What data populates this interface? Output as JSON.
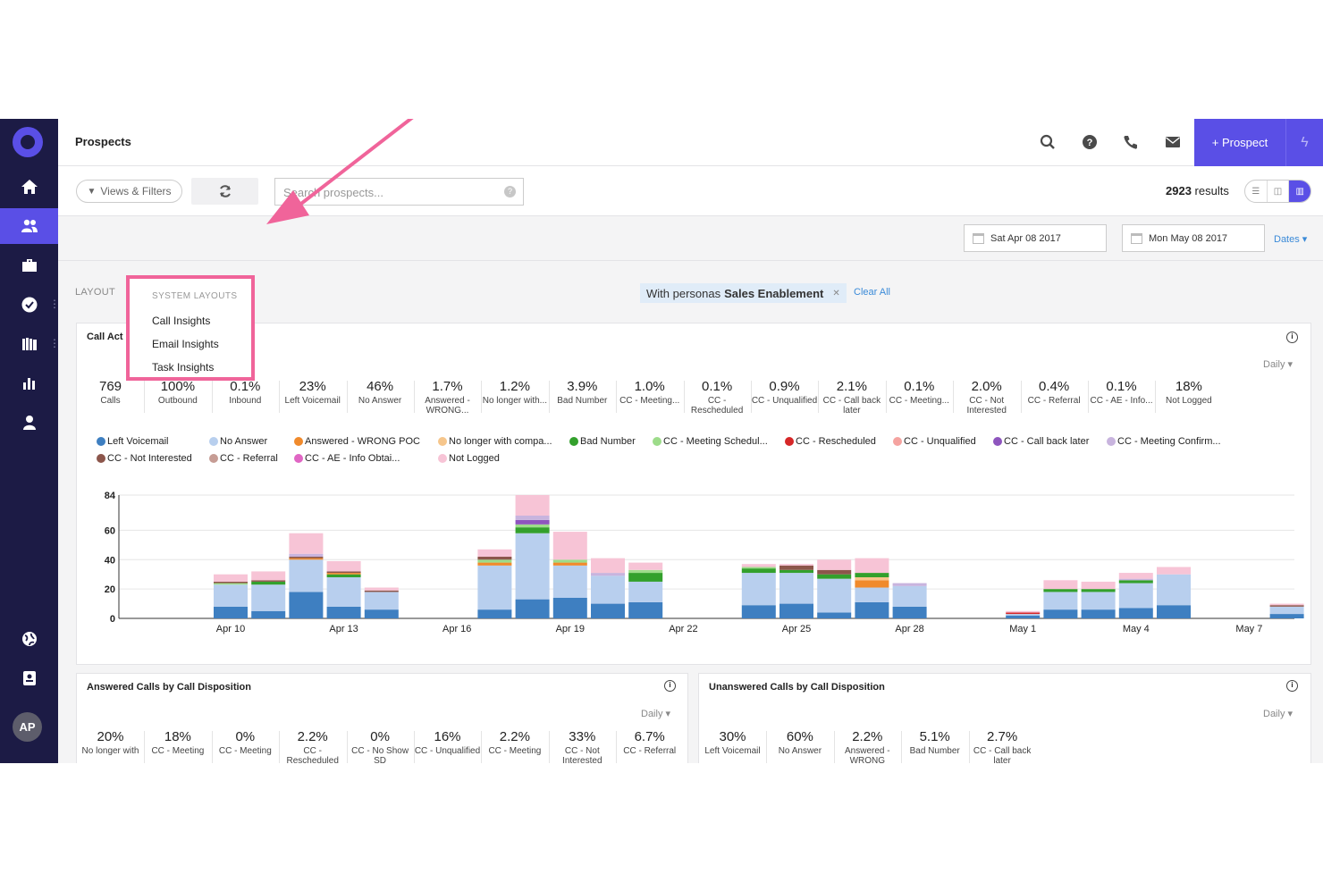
{
  "header": {
    "title": "Prospects",
    "prospect_button": "+ Prospect"
  },
  "sidebar": {
    "avatar": "AP",
    "items": [
      "home",
      "prospects",
      "briefcase",
      "tasks",
      "library",
      "reports",
      "person",
      "globe",
      "contacts"
    ]
  },
  "toolbar": {
    "views_filters": "Views & Filters",
    "search_placeholder": "Search prospects...",
    "results_count": "2923",
    "results_label": "results"
  },
  "dates": {
    "start": "Sat Apr 08 2017",
    "end": "Mon May 08 2017",
    "dates_label": "Dates"
  },
  "layout": {
    "label": "LAYOUT",
    "menu_header": "SYSTEM LAYOUTS",
    "items": [
      "Call Insights",
      "Email Insights",
      "Task Insights"
    ]
  },
  "filter": {
    "prefix": "With personas",
    "value": "Sales Enablement",
    "clear_all": "Clear All"
  },
  "call_activity": {
    "title": "Call Act",
    "period": "Daily",
    "stats": [
      {
        "v": "769",
        "l": "Calls"
      },
      {
        "v": "100%",
        "l": "Outbound"
      },
      {
        "v": "0.1%",
        "l": "Inbound"
      },
      {
        "v": "23%",
        "l": "Left Voicemail"
      },
      {
        "v": "46%",
        "l": "No Answer"
      },
      {
        "v": "1.7%",
        "l": "Answered - WRONG..."
      },
      {
        "v": "1.2%",
        "l": "No longer with..."
      },
      {
        "v": "3.9%",
        "l": "Bad Number"
      },
      {
        "v": "1.0%",
        "l": "CC - Meeting..."
      },
      {
        "v": "0.1%",
        "l": "CC - Rescheduled"
      },
      {
        "v": "0.9%",
        "l": "CC - Unqualified"
      },
      {
        "v": "2.1%",
        "l": "CC - Call back later"
      },
      {
        "v": "0.1%",
        "l": "CC - Meeting..."
      },
      {
        "v": "2.0%",
        "l": "CC - Not Interested"
      },
      {
        "v": "0.4%",
        "l": "CC - Referral"
      },
      {
        "v": "0.1%",
        "l": "CC - AE - Info..."
      },
      {
        "v": "18%",
        "l": "Not Logged"
      }
    ],
    "legend": [
      {
        "name": "Left Voicemail",
        "color": "#3e7fc1"
      },
      {
        "name": "No Answer",
        "color": "#b8cfee"
      },
      {
        "name": "Answered - WRONG POC",
        "color": "#f08a2c"
      },
      {
        "name": "No longer with compa...",
        "color": "#f6c68c"
      },
      {
        "name": "Bad Number",
        "color": "#33a02c"
      },
      {
        "name": "CC - Meeting Schedul...",
        "color": "#9ddc8a"
      },
      {
        "name": "CC - Rescheduled",
        "color": "#d62728"
      },
      {
        "name": "CC - Unqualified",
        "color": "#f5a3a0"
      },
      {
        "name": "CC - Call back later",
        "color": "#8e55be"
      },
      {
        "name": "CC - Meeting Confirm...",
        "color": "#c8b4de"
      },
      {
        "name": "CC - Not Interested",
        "color": "#8c564b"
      },
      {
        "name": "CC - Referral",
        "color": "#c69c94"
      },
      {
        "name": "CC - AE - Info Obtai...",
        "color": "#e066c4"
      },
      {
        "name": "Not Logged",
        "color": "#f7c4d6"
      }
    ]
  },
  "chart_data": {
    "type": "bar",
    "stacked": true,
    "ylim": [
      0,
      84
    ],
    "yticks": [
      0,
      20,
      40,
      60,
      84
    ],
    "x_labels": [
      {
        "label": "Apr 10",
        "day": 2
      },
      {
        "label": "Apr 13",
        "day": 5
      },
      {
        "label": "Apr 16",
        "day": 8
      },
      {
        "label": "Apr 19",
        "day": 11
      },
      {
        "label": "Apr 22",
        "day": 14
      },
      {
        "label": "Apr 25",
        "day": 17
      },
      {
        "label": "Apr 28",
        "day": 20
      },
      {
        "label": "May 1",
        "day": 23
      },
      {
        "label": "May 4",
        "day": 26
      },
      {
        "label": "May 7",
        "day": 29
      }
    ],
    "bars": [
      {
        "day": 2,
        "segments": [
          [
            "Left Voicemail",
            8
          ],
          [
            "No Answer",
            15
          ],
          [
            "CC - Meeting Schedul...",
            1
          ],
          [
            "CC - Not Interested",
            1
          ],
          [
            "Not Logged",
            5
          ]
        ]
      },
      {
        "day": 3,
        "segments": [
          [
            "Left Voicemail",
            5
          ],
          [
            "No Answer",
            18
          ],
          [
            "Bad Number",
            2
          ],
          [
            "CC - Not Interested",
            1
          ],
          [
            "Not Logged",
            6
          ]
        ]
      },
      {
        "day": 4,
        "segments": [
          [
            "Left Voicemail",
            18
          ],
          [
            "No Answer",
            22
          ],
          [
            "Answered - WRONG POC",
            1
          ],
          [
            "CC - Not Interested",
            1
          ],
          [
            "CC - Meeting Confirm...",
            2
          ],
          [
            "Not Logged",
            14
          ]
        ]
      },
      {
        "day": 5,
        "segments": [
          [
            "Left Voicemail",
            8
          ],
          [
            "No Answer",
            20
          ],
          [
            "Bad Number",
            2
          ],
          [
            "Answered - WRONG POC",
            1
          ],
          [
            "CC - Not Interested",
            1
          ],
          [
            "Not Logged",
            7
          ]
        ]
      },
      {
        "day": 6,
        "segments": [
          [
            "Left Voicemail",
            6
          ],
          [
            "No Answer",
            12
          ],
          [
            "CC - Not Interested",
            1
          ],
          [
            "Not Logged",
            2
          ]
        ]
      },
      {
        "day": 9,
        "segments": [
          [
            "Left Voicemail",
            6
          ],
          [
            "No Answer",
            30
          ],
          [
            "Answered - WRONG POC",
            2
          ],
          [
            "CC - Meeting Schedul...",
            2
          ],
          [
            "CC - Not Interested",
            2
          ],
          [
            "Not Logged",
            5
          ]
        ]
      },
      {
        "day": 10,
        "segments": [
          [
            "Left Voicemail",
            13
          ],
          [
            "No Answer",
            45
          ],
          [
            "Bad Number",
            4
          ],
          [
            "CC - Meeting Schedul...",
            2
          ],
          [
            "CC - Call back later",
            3
          ],
          [
            "CC - Meeting Confirm...",
            3
          ],
          [
            "Not Logged",
            14
          ]
        ]
      },
      {
        "day": 11,
        "segments": [
          [
            "Left Voicemail",
            14
          ],
          [
            "No Answer",
            22
          ],
          [
            "Answered - WRONG POC",
            2
          ],
          [
            "CC - Meeting Schedul...",
            2
          ],
          [
            "Not Logged",
            19
          ]
        ]
      },
      {
        "day": 12,
        "segments": [
          [
            "Left Voicemail",
            10
          ],
          [
            "No Answer",
            19
          ],
          [
            "CC - Meeting Confirm...",
            2
          ],
          [
            "Not Logged",
            10
          ]
        ]
      },
      {
        "day": 13,
        "segments": [
          [
            "Left Voicemail",
            11
          ],
          [
            "No Answer",
            14
          ],
          [
            "Bad Number",
            6
          ],
          [
            "CC - Meeting Schedul...",
            2
          ],
          [
            "Not Logged",
            5
          ]
        ]
      },
      {
        "day": 16,
        "segments": [
          [
            "Left Voicemail",
            9
          ],
          [
            "No Answer",
            22
          ],
          [
            "Bad Number",
            3
          ],
          [
            "CC - Meeting Schedul...",
            1
          ],
          [
            "Not Logged",
            2
          ]
        ]
      },
      {
        "day": 17,
        "segments": [
          [
            "Left Voicemail",
            10
          ],
          [
            "No Answer",
            21
          ],
          [
            "Bad Number",
            2
          ],
          [
            "CC - Not Interested",
            3
          ],
          [
            "Not Logged",
            1
          ]
        ]
      },
      {
        "day": 18,
        "segments": [
          [
            "Left Voicemail",
            4
          ],
          [
            "No Answer",
            23
          ],
          [
            "Bad Number",
            3
          ],
          [
            "CC - Not Interested",
            3
          ],
          [
            "Not Logged",
            7
          ]
        ]
      },
      {
        "day": 19,
        "segments": [
          [
            "Left Voicemail",
            11
          ],
          [
            "No Answer",
            10
          ],
          [
            "Answered - WRONG POC",
            5
          ],
          [
            "No longer with compa...",
            2
          ],
          [
            "Bad Number",
            3
          ],
          [
            "Not Logged",
            10
          ]
        ]
      },
      {
        "day": 20,
        "segments": [
          [
            "Left Voicemail",
            8
          ],
          [
            "No Answer",
            14
          ],
          [
            "CC - Meeting Confirm...",
            2
          ]
        ]
      },
      {
        "day": 23,
        "segments": [
          [
            "Left Voicemail",
            2
          ],
          [
            "No Answer",
            1
          ],
          [
            "CC - Rescheduled",
            1
          ],
          [
            "Not Logged",
            1
          ]
        ]
      },
      {
        "day": 24,
        "segments": [
          [
            "Left Voicemail",
            6
          ],
          [
            "No Answer",
            12
          ],
          [
            "Bad Number",
            2
          ],
          [
            "Not Logged",
            6
          ]
        ]
      },
      {
        "day": 25,
        "segments": [
          [
            "Left Voicemail",
            6
          ],
          [
            "No Answer",
            12
          ],
          [
            "Bad Number",
            2
          ],
          [
            "Not Logged",
            5
          ]
        ]
      },
      {
        "day": 26,
        "segments": [
          [
            "Left Voicemail",
            7
          ],
          [
            "No Answer",
            17
          ],
          [
            "Bad Number",
            2
          ],
          [
            "CC - Meeting Confirm...",
            1
          ],
          [
            "Not Logged",
            4
          ]
        ]
      },
      {
        "day": 27,
        "segments": [
          [
            "Left Voicemail",
            9
          ],
          [
            "No Answer",
            21
          ],
          [
            "Not Logged",
            5
          ]
        ]
      },
      {
        "day": 30,
        "segments": [
          [
            "Left Voicemail",
            3
          ],
          [
            "No Answer",
            5
          ],
          [
            "CC - Not Interested",
            1
          ],
          [
            "Not Logged",
            1
          ]
        ]
      }
    ]
  },
  "answered": {
    "title": "Answered Calls by Call Disposition",
    "period": "Daily",
    "stats": [
      {
        "v": "20%",
        "l": "No longer with"
      },
      {
        "v": "18%",
        "l": "CC - Meeting"
      },
      {
        "v": "0%",
        "l": "CC - Meeting"
      },
      {
        "v": "2.2%",
        "l": "CC - Rescheduled"
      },
      {
        "v": "0%",
        "l": "CC - No Show SD"
      },
      {
        "v": "16%",
        "l": "CC - Unqualified"
      },
      {
        "v": "2.2%",
        "l": "CC - Meeting"
      },
      {
        "v": "33%",
        "l": "CC - Not Interested"
      },
      {
        "v": "6.7%",
        "l": "CC - Referral"
      }
    ]
  },
  "unanswered": {
    "title": "Unanswered Calls by Call Disposition",
    "period": "Daily",
    "stats": [
      {
        "v": "30%",
        "l": "Left Voicemail"
      },
      {
        "v": "60%",
        "l": "No Answer"
      },
      {
        "v": "2.2%",
        "l": "Answered - WRONG"
      },
      {
        "v": "5.1%",
        "l": "Bad Number"
      },
      {
        "v": "2.7%",
        "l": "CC - Call back later"
      }
    ]
  }
}
